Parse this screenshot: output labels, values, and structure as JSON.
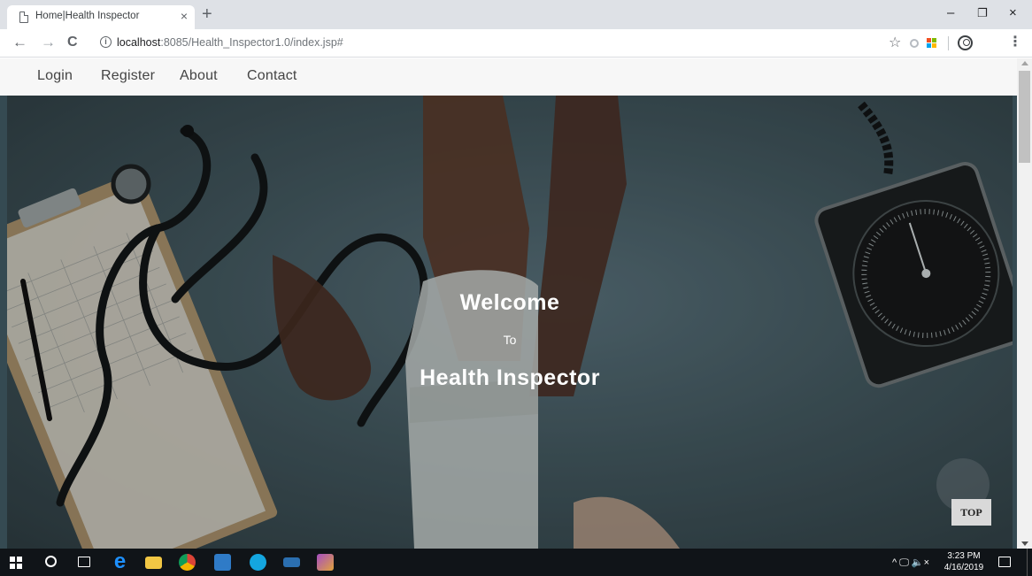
{
  "browser": {
    "tab_title": "Home|Health Inspector",
    "tab_close": "×",
    "new_tab": "+",
    "url_host": "localhost",
    "url_path": ":8085/Health_Inspector1.0/index.jsp#",
    "back": "←",
    "forward": "→",
    "reload": "C",
    "star": "☆",
    "menu": "⋮",
    "minimize": "–",
    "restore": "❐",
    "close": "×",
    "info": "i"
  },
  "site_nav": {
    "items": [
      "Login",
      "Register",
      "About",
      "Contact"
    ]
  },
  "hero": {
    "welcome": "Welcome",
    "to": "To",
    "brand": "Health Inspector",
    "top_button": "TOP"
  },
  "taskbar": {
    "time": "3:23 PM",
    "date": "4/16/2019",
    "tray_glyphs": "^ 🖵 🔈×",
    "apps": [
      {
        "name": "edge",
        "color": "#1e90ff"
      },
      {
        "name": "file-explorer",
        "color": "#f2c744"
      },
      {
        "name": "chrome",
        "color": "#e3a122"
      },
      {
        "name": "outlook",
        "color": "#2f7bc7"
      },
      {
        "name": "skype",
        "color": "#14a6e0"
      },
      {
        "name": "remote-desktop",
        "color": "#2b6fb0"
      },
      {
        "name": "utility-app",
        "color": "#a64ec3"
      }
    ]
  },
  "colors": {
    "accent": "#1a73e8",
    "hero_bg": "#43585f",
    "nav_bg": "#f7f7f7",
    "taskbar_bg": "#101418"
  }
}
